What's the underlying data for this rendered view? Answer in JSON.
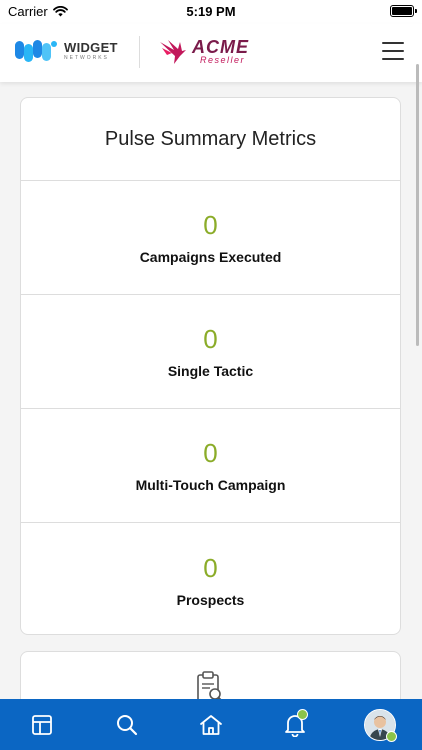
{
  "status_bar": {
    "carrier": "Carrier",
    "time": "5:19 PM"
  },
  "header": {
    "widget_logo": {
      "name": "WIDGET",
      "sub": "NETWORKS"
    },
    "acme_logo": {
      "name": "ACME",
      "sub": "Reseller"
    },
    "menu_icon": "hamburger-icon"
  },
  "summary": {
    "title": "Pulse Summary Metrics",
    "metrics": [
      {
        "value": "0",
        "label": "Campaigns Executed"
      },
      {
        "value": "0",
        "label": "Single Tactic"
      },
      {
        "value": "0",
        "label": "Multi-Touch Campaign"
      },
      {
        "value": "0",
        "label": "Prospects"
      }
    ]
  },
  "bottom_nav": {
    "items": [
      "dashboard-icon",
      "search-icon",
      "home-icon",
      "bell-icon",
      "avatar"
    ]
  },
  "colors": {
    "accent_green": "#8bac29",
    "nav_blue": "#0b66c3",
    "acme_maroon": "#7a1b4a"
  }
}
